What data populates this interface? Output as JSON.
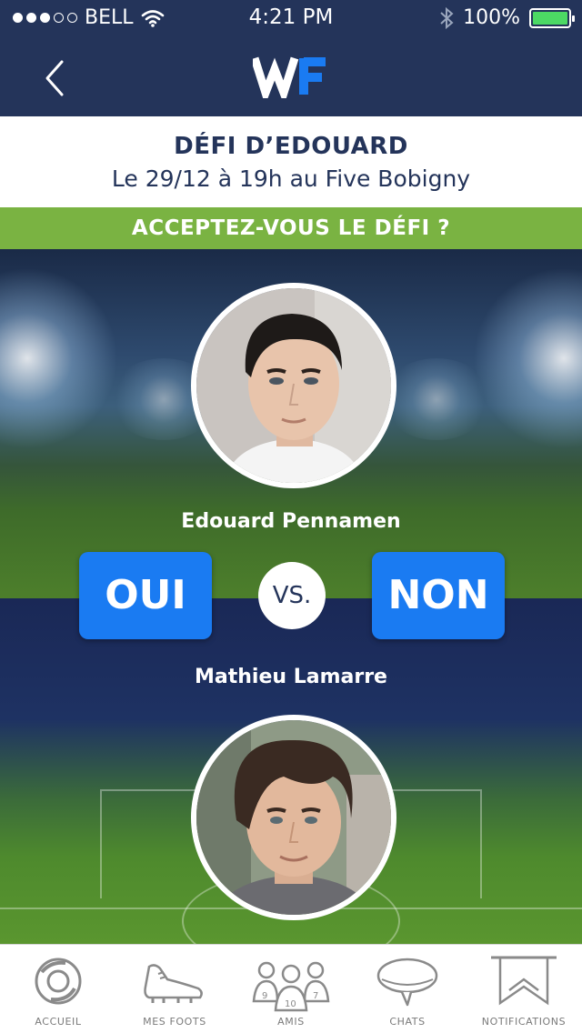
{
  "status_bar": {
    "carrier": "BELL",
    "time": "4:21 PM",
    "battery": "100%",
    "signal_dots_filled": 3,
    "signal_dots_total": 5
  },
  "nav": {
    "back_icon": "chevron-left-icon",
    "logo_text": "WF"
  },
  "challenge": {
    "title": "DÉFI D’EDOUARD",
    "subtitle": "Le 29/12 à 19h au Five Bobigny",
    "prompt": "ACCEPTEZ-VOUS LE DÉFI ?"
  },
  "players": {
    "challenger": "Edouard Pennamen",
    "opponent": "Mathieu Lamarre"
  },
  "actions": {
    "accept": "OUI",
    "versus": "VS.",
    "decline": "NON"
  },
  "tabs": [
    {
      "label": "ACCUEIL",
      "icon": "ball-swirl-icon"
    },
    {
      "label": "MES FOOTS",
      "icon": "football-boot-icon"
    },
    {
      "label": "AMIS",
      "icon": "team-players-icon"
    },
    {
      "label": "CHATS",
      "icon": "speech-bubble-icon"
    },
    {
      "label": "NOTIFICATIONS",
      "icon": "bookmark-ribbon-icon"
    }
  ],
  "colors": {
    "navy": "#24345a",
    "accent_blue": "#1a7bf2",
    "banner_green": "#7ab342",
    "battery_green": "#4cd964"
  }
}
